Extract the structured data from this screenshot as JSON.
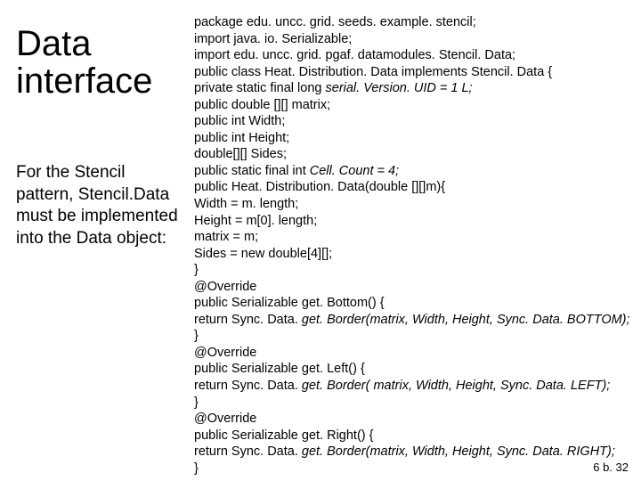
{
  "left": {
    "title_l1": "Data",
    "title_l2": "interface",
    "caption": "For the Stencil pattern, Stencil.Data must be implemented into the Data object:"
  },
  "code": {
    "l1": "package edu. uncc. grid. seeds. example. stencil;",
    "l2": "import java. io. Serializable;",
    "l3": "import edu. uncc. grid. pgaf. datamodules. Stencil. Data;",
    "l4": "public class Heat. Distribution. Data implements Stencil. Data {",
    "l5a": "private static final long ",
    "l5b": "serial. Version. UID = 1 L;",
    "l6": "public double [][] matrix;",
    "l7": "public int Width;",
    "l8": "public int Height;",
    "l9": "double[][] Sides;",
    "l10a": "public static final int ",
    "l10b": "Cell. Count = 4;",
    "l11": "public Heat. Distribution. Data(double [][]m){",
    "l12": "Width = m. length;",
    "l13": "Height = m[0]. length;",
    "l14": "matrix = m;",
    "l15": "Sides = new double[4][];",
    "l16": "}",
    "l17": "@Override",
    "l18": "public Serializable get. Bottom() {",
    "l19a": "return Sync. Data. ",
    "l19b": "get. Border(matrix, Width, Height, Sync. Data. BOTTOM);",
    "l20": "}",
    "l21": "@Override",
    "l22": "public Serializable get. Left() {",
    "l23a": "return Sync. Data. ",
    "l23b": "get. Border( matrix, Width, Height, Sync. Data. LEFT);",
    "l24": "}",
    "l25": "@Override",
    "l26": "public Serializable get. Right() {",
    "l27a": "return Sync. Data. ",
    "l27b": "get. Border(matrix, Width, Height, Sync. Data. RIGHT);",
    "l28": "}"
  },
  "pagenum": "6 b. 32"
}
